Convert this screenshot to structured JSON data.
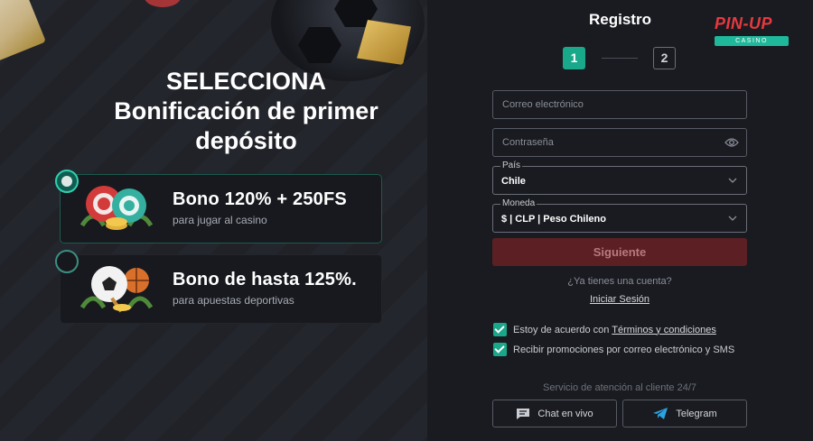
{
  "promo": {
    "title_line1": "SELECCIONA",
    "title_line2": "Bonificación de primer",
    "title_line3": "depósito",
    "bonuses": [
      {
        "title": "Bono 120% + 250FS",
        "subtitle": "para jugar al casino",
        "selected": true
      },
      {
        "title": "Bono de hasta 125%.",
        "subtitle": "para apuestas deportivas",
        "selected": false
      }
    ]
  },
  "form": {
    "title": "Registro",
    "logo": {
      "main": "PIN-UP",
      "sub": "CASINO"
    },
    "steps": [
      "1",
      "2"
    ],
    "email_placeholder": "Correo electrónico",
    "password_placeholder": "Contraseña",
    "country": {
      "label": "País",
      "value": "Chile"
    },
    "currency": {
      "label": "Moneda",
      "value": "$ | CLP | Peso Chileno"
    },
    "next_label": "Siguiente",
    "have_account": "¿Ya tienes una cuenta?",
    "login_label": "Iniciar Sesión",
    "terms_prefix": "Estoy de acuerdo con ",
    "terms_link": "Términos y condiciones",
    "promo_consent": "Recibir promociones por correo electrónico y SMS",
    "support_text": "Servicio de atención al cliente 24/7",
    "chat_label": "Chat en vivo",
    "telegram_label": "Telegram"
  },
  "colors": {
    "accent": "#1aa88a",
    "brand_red": "#e63a3f",
    "next_button": "#5c1f24"
  }
}
